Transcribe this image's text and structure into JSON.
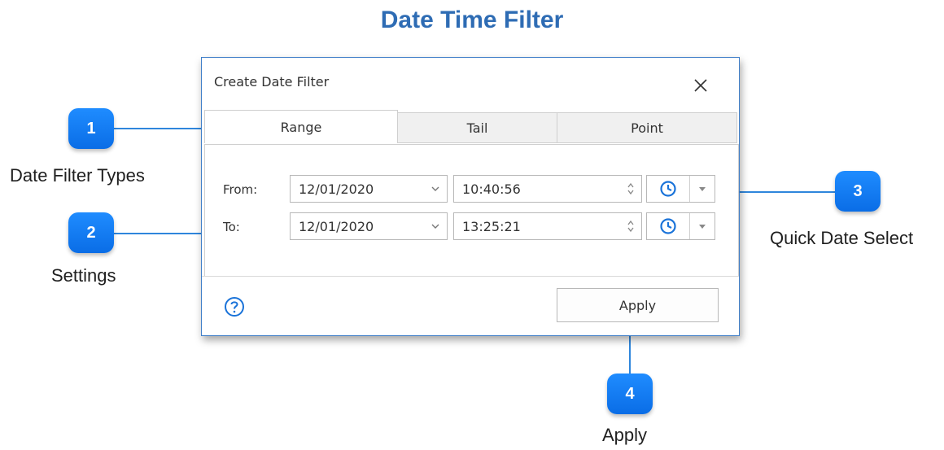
{
  "page": {
    "title": "Date Time Filter"
  },
  "callouts": [
    {
      "number": "1",
      "label": "Date Filter Types"
    },
    {
      "number": "2",
      "label": "Settings"
    },
    {
      "number": "3",
      "label": "Quick Date Select"
    },
    {
      "number": "4",
      "label": "Apply"
    }
  ],
  "dialog": {
    "title": "Create Date Filter",
    "tabs": [
      {
        "label": "Range",
        "active": true
      },
      {
        "label": "Tail",
        "active": false
      },
      {
        "label": "Point",
        "active": false
      }
    ],
    "rows": [
      {
        "label": "From:",
        "date": "12/01/2020",
        "time": "10:40:56"
      },
      {
        "label": "To:",
        "date": "12/01/2020",
        "time": "13:25:21"
      }
    ],
    "apply_label": "Apply"
  },
  "colors": {
    "title": "#2e6cb4",
    "badge": "#1480f5",
    "accent": "#1a73d9",
    "border": "#3f7ec8"
  },
  "icons": [
    "close-icon",
    "chevron-down-icon",
    "spinner-icon",
    "clock-icon",
    "help-icon"
  ]
}
